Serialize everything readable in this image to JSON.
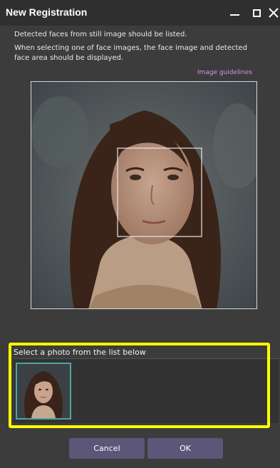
{
  "window": {
    "title": "New Registration"
  },
  "instructions": {
    "line1": "Detected faces from still image should be listed.",
    "line2": "When selecting one of face images, the face image and detected face area should be displayed."
  },
  "links": {
    "image_guidelines": "Image guidelines"
  },
  "photo_list": {
    "label": "Select a photo from the list below",
    "items": [
      {
        "icon": "portrait-thumbnail-icon",
        "selected": true
      }
    ]
  },
  "buttons": {
    "cancel": "Cancel",
    "ok": "OK"
  },
  "colors": {
    "accent_highlight": "#ffff00",
    "link": "#d493e6",
    "button": "#5a5778",
    "selected_thumbnail_border": "#4aa6a0"
  }
}
